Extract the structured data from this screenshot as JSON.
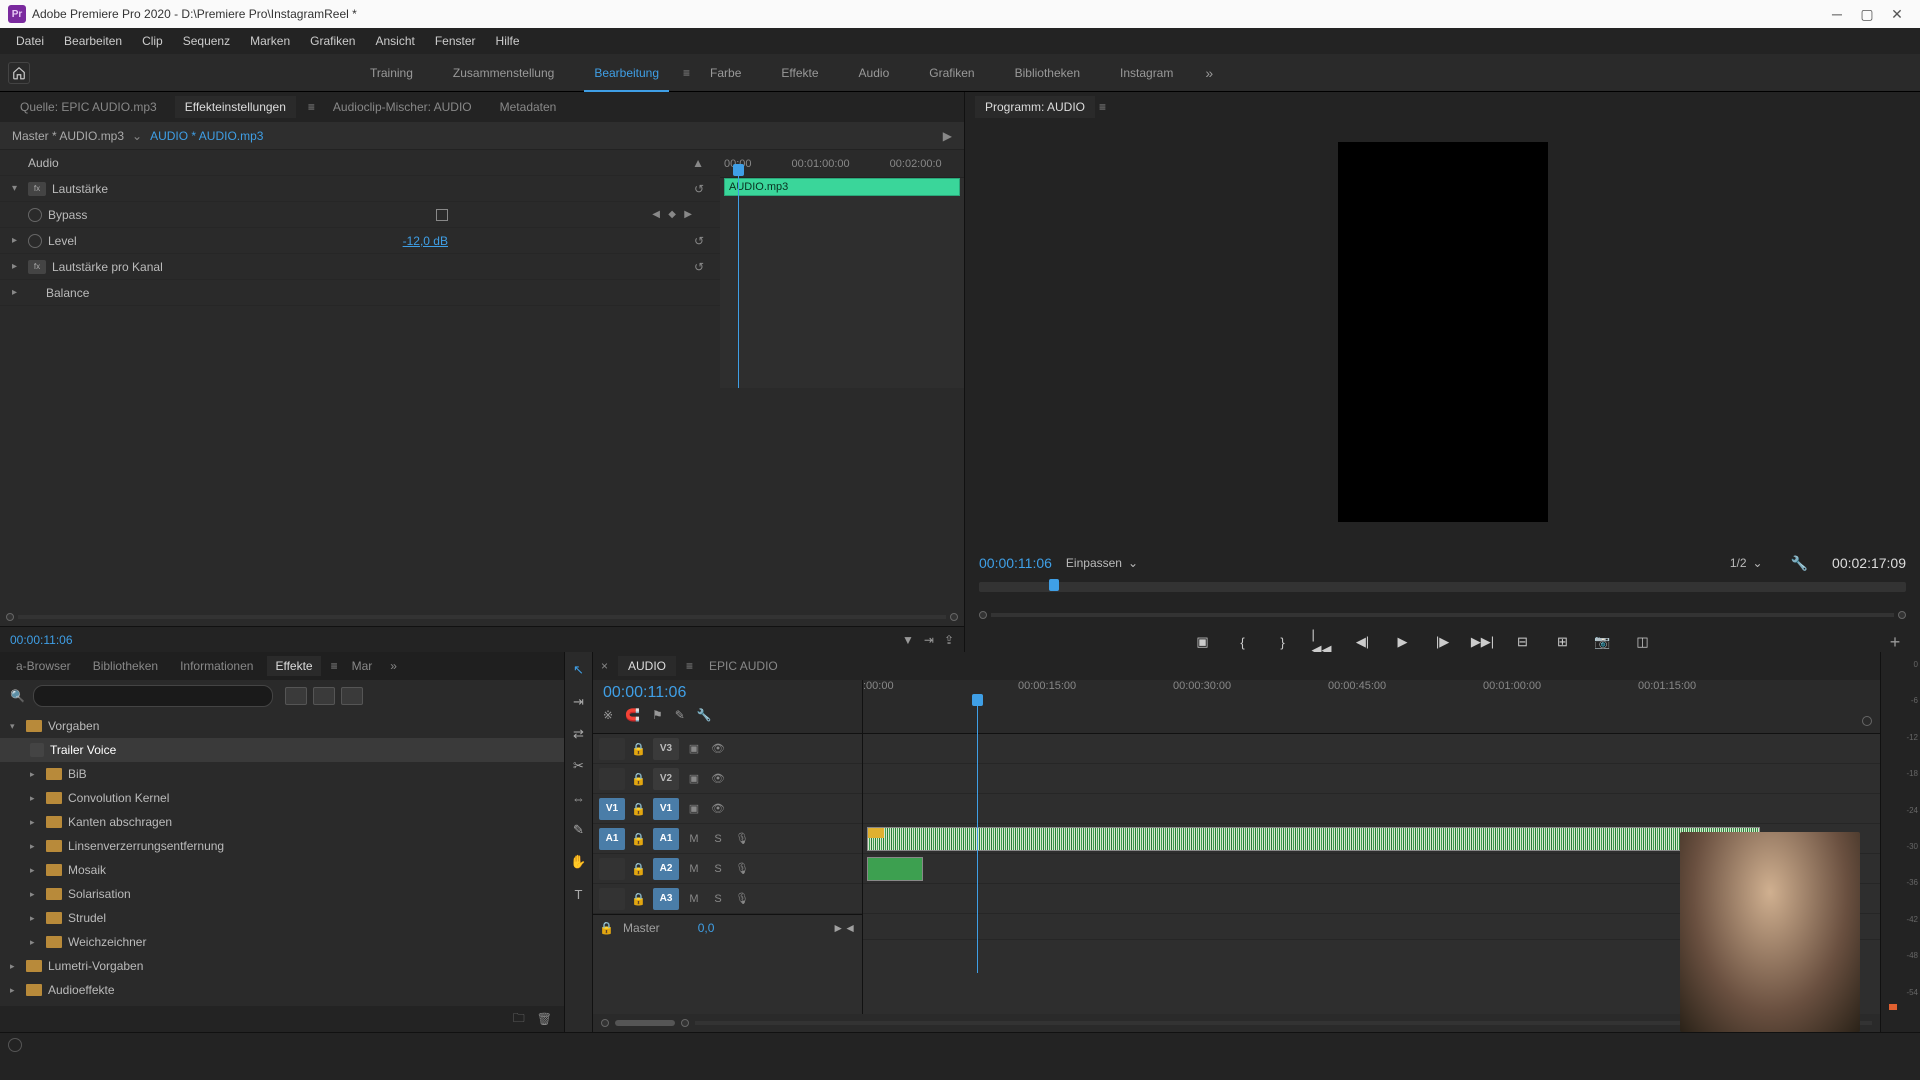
{
  "window": {
    "title": "Adobe Premiere Pro 2020 - D:\\Premiere Pro\\InstagramReel *"
  },
  "menubar": [
    "Datei",
    "Bearbeiten",
    "Clip",
    "Sequenz",
    "Marken",
    "Grafiken",
    "Ansicht",
    "Fenster",
    "Hilfe"
  ],
  "workspaces": {
    "items": [
      "Training",
      "Zusammenstellung",
      "Bearbeitung",
      "Farbe",
      "Effekte",
      "Audio",
      "Grafiken",
      "Bibliotheken",
      "Instagram"
    ],
    "active": "Bearbeitung"
  },
  "source_tabs": {
    "items": [
      "Quelle: EPIC AUDIO.mp3",
      "Effekteinstellungen",
      "Audioclip-Mischer: AUDIO",
      "Metadaten"
    ],
    "active": "Effekteinstellungen"
  },
  "effect_controls": {
    "master": "Master * AUDIO.mp3",
    "clip": "AUDIO * AUDIO.mp3",
    "clip_label": "AUDIO.mp3",
    "ruler": [
      "00:00",
      "00:01:00:00",
      "00:02:00:0"
    ],
    "section": "Audio",
    "params": {
      "volume": "Lautstärke",
      "bypass": "Bypass",
      "level": "Level",
      "level_val": "-12,0 dB",
      "channel_volume": "Lautstärke pro Kanal",
      "balance": "Balance"
    },
    "src_time": "00:00:11:06"
  },
  "program": {
    "tab": "Programm: AUDIO",
    "time": "00:00:11:06",
    "zoom": "Einpassen",
    "resolution": "1/2",
    "duration": "00:02:17:09"
  },
  "effects_panel": {
    "tabs": [
      "a-Browser",
      "Bibliotheken",
      "Informationen",
      "Effekte",
      "Mar"
    ],
    "active": "Effekte",
    "search_placeholder": "",
    "tree": [
      {
        "label": "Vorgaben",
        "type": "folder",
        "open": true
      },
      {
        "label": "Trailer Voice",
        "type": "preset",
        "indent": true,
        "selected": true
      },
      {
        "label": "BiB",
        "type": "folder"
      },
      {
        "label": "Convolution Kernel",
        "type": "folder"
      },
      {
        "label": "Kanten abschragen",
        "type": "folder"
      },
      {
        "label": "Linsenverzerrungsentfernung",
        "type": "folder"
      },
      {
        "label": "Mosaik",
        "type": "folder"
      },
      {
        "label": "Solarisation",
        "type": "folder"
      },
      {
        "label": "Strudel",
        "type": "folder"
      },
      {
        "label": "Weichzeichner",
        "type": "folder"
      },
      {
        "label": "Lumetri-Vorgaben",
        "type": "folder"
      },
      {
        "label": "Audioeffekte",
        "type": "folder"
      }
    ]
  },
  "timeline": {
    "tabs": [
      "AUDIO",
      "EPIC AUDIO"
    ],
    "active": "AUDIO",
    "time": "00:00:11:06",
    "ruler": [
      ":00:00",
      "00:00:15:00",
      "00:00:30:00",
      "00:00:45:00",
      "00:01:00:00",
      "00:01:15:00"
    ],
    "tracks": {
      "v3": "V3",
      "v2": "V2",
      "v1": "V1",
      "a1": "A1",
      "a2": "A2",
      "a3": "A3"
    },
    "src_v1": "V1",
    "src_a1": "A1",
    "buttons": {
      "m": "M",
      "s": "S"
    },
    "master": "Master",
    "master_val": "0,0"
  },
  "meters_scale": [
    "0",
    "-6",
    "-12",
    "-18",
    "-24",
    "-30",
    "-36",
    "-42",
    "-48",
    "-54",
    ""
  ]
}
